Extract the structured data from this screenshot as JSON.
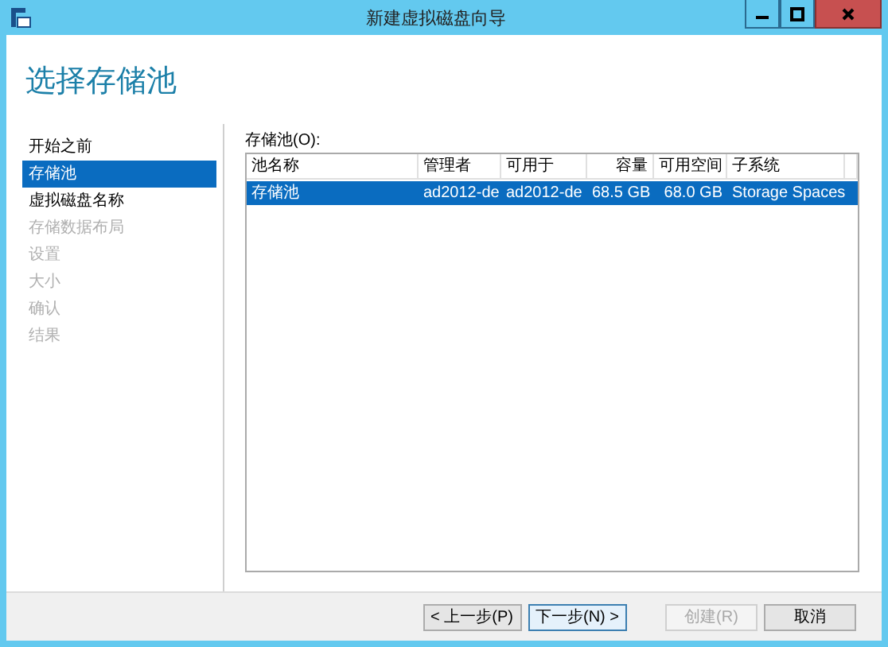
{
  "window": {
    "title": "新建虚拟磁盘向导"
  },
  "heading": "选择存储池",
  "steps": [
    {
      "label": "开始之前",
      "selected": false,
      "disabled": false
    },
    {
      "label": "存储池",
      "selected": true,
      "disabled": false
    },
    {
      "label": "虚拟磁盘名称",
      "selected": false,
      "disabled": false
    },
    {
      "label": "存储数据布局",
      "selected": false,
      "disabled": true
    },
    {
      "label": "设置",
      "selected": false,
      "disabled": true
    },
    {
      "label": "大小",
      "selected": false,
      "disabled": true
    },
    {
      "label": "确认",
      "selected": false,
      "disabled": true
    },
    {
      "label": "结果",
      "selected": false,
      "disabled": true
    }
  ],
  "pool_list": {
    "label": "存储池(O):",
    "columns": [
      "池名称",
      "管理者",
      "可用于",
      "容量",
      "可用空间",
      "子系统"
    ],
    "rows": [
      {
        "selected": true,
        "cells": [
          "存储池",
          "ad2012-de",
          "ad2012-de",
          "68.5 GB",
          "68.0 GB",
          "Storage Spaces"
        ]
      }
    ]
  },
  "buttons": [
    {
      "label": "< 上一步(P)",
      "disabled": false,
      "focused": false
    },
    {
      "label": "下一步(N) >",
      "disabled": false,
      "focused": true
    },
    {
      "label": "创建(R)",
      "disabled": true,
      "focused": false
    },
    {
      "label": "取消",
      "disabled": false,
      "focused": false
    }
  ]
}
